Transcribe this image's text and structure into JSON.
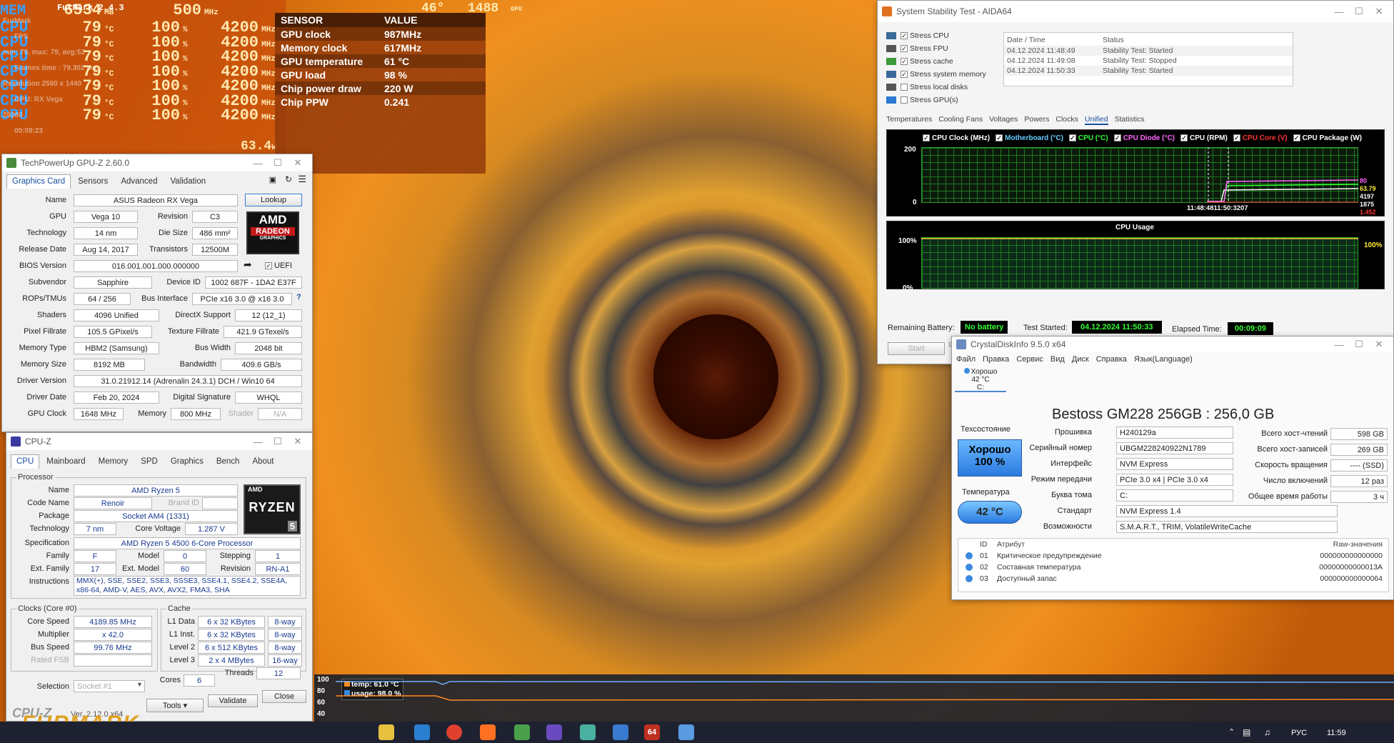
{
  "osd": {
    "rows": [
      {
        "name": "CPU",
        "v1": "79",
        "u1": "°C",
        "v2": "100",
        "u2": "%",
        "v3": "4200",
        "u3": "MHz"
      },
      {
        "name": "CPU",
        "v1": "79",
        "u1": "°C",
        "v2": "100",
        "u2": "%",
        "v3": "4200",
        "u3": "MHz"
      },
      {
        "name": "CPU",
        "v1": "79",
        "u1": "°C",
        "v2": "100",
        "u2": "%",
        "v3": "4200",
        "u3": "MHz"
      },
      {
        "name": "CPU",
        "v1": "79",
        "u1": "°C",
        "v2": "100",
        "u2": "%",
        "v3": "4200",
        "u3": "MHz"
      },
      {
        "name": "CPU",
        "v1": "79",
        "u1": "°C",
        "v2": "100",
        "u2": "%",
        "v3": "4200",
        "u3": "MHz"
      },
      {
        "name": "CPU",
        "v1": "79",
        "u1": "°C",
        "v2": "100",
        "u2": "%",
        "v3": "4200",
        "u3": "MHz"
      },
      {
        "name": "CPU",
        "v1": "79",
        "u1": "°C",
        "v2": "100",
        "u2": "%",
        "v3": "4200",
        "u3": "MHz"
      }
    ],
    "mem_row": {
      "name": "MEM",
      "v1": "6534",
      "u1": "MB",
      "v2": "500",
      "u2": "MHz"
    },
    "top_text": "FurMark 2.4.3",
    "gpu_top_fps": "1488",
    "gpu_top_unit": "GPU",
    "gpu_top_temp": "46°",
    "cpu_power": "63.4",
    "cpu_power_unit": "W",
    "faint_labels": [
      "FurMark",
      "FPS",
      "min: 79, max: 79, avg:52",
      "Frames time : 79.302 ms",
      "Resolution 2560 x 1440",
      "GPU: RX Vega",
      "29280",
      "00:09:23"
    ]
  },
  "sensor": {
    "header": [
      "SENSOR",
      "VALUE"
    ],
    "rows": [
      [
        "GPU clock",
        "987MHz"
      ],
      [
        "Memory clock",
        "617MHz"
      ],
      [
        "GPU temperature",
        "61 °C"
      ],
      [
        "GPU load",
        "98 %"
      ],
      [
        "Chip power draw",
        "220 W"
      ],
      [
        "Chip PPW",
        "0.241"
      ]
    ]
  },
  "gpuz": {
    "title": "TechPowerUp GPU-Z 2.60.0",
    "tabs": [
      "Graphics Card",
      "Sensors",
      "Advanced",
      "Validation"
    ],
    "lookup": "Lookup",
    "uefi": "UEFI",
    "rows": {
      "name_l": "Name",
      "name_v": "ASUS Radeon RX Vega",
      "gpu_l": "GPU",
      "gpu_v": "Vega 10",
      "rev_l": "Revision",
      "rev_v": "C3",
      "tech_l": "Technology",
      "tech_v": "14 nm",
      "die_l": "Die Size",
      "die_v": "486 mm²",
      "rel_l": "Release Date",
      "rel_v": "Aug 14, 2017",
      "tr_l": "Transistors",
      "tr_v": "12500M",
      "bios_l": "BIOS Version",
      "bios_v": "016.001.001.000.000000",
      "sub_l": "Subvendor",
      "sub_v": "Sapphire",
      "dev_l": "Device ID",
      "dev_v": "1002 687F - 1DA2 E37F",
      "rop_l": "ROPs/TMUs",
      "rop_v": "64 / 256",
      "bus_l": "Bus Interface",
      "bus_v": "PCIe x16 3.0 @ x16 3.0",
      "sh_l": "Shaders",
      "sh_v": "4096 Unified",
      "dx_l": "DirectX Support",
      "dx_v": "12 (12_1)",
      "pf_l": "Pixel Fillrate",
      "pf_v": "105.5 GPixel/s",
      "tf_l": "Texture Fillrate",
      "tf_v": "421.9 GTexel/s",
      "mt_l": "Memory Type",
      "mt_v": "HBM2 (Samsung)",
      "bw_l": "Bus Width",
      "bw_v": "2048 bit",
      "ms_l": "Memory Size",
      "ms_v": "8192 MB",
      "band_l": "Bandwidth",
      "band_v": "409.6 GB/s",
      "dv_l": "Driver Version",
      "dv_v": "31.0.21912.14 (Adrenalin 24.3.1) DCH / Win10 64",
      "dd_l": "Driver Date",
      "dd_v": "Feb 20, 2024",
      "ds_l": "Digital Signature",
      "ds_v": "WHQL",
      "gc_l": "GPU Clock",
      "gc_v": "1648 MHz",
      "mem_l": "Memory",
      "mem_v": "800 MHz",
      "shd_l": "Shader",
      "shd_v": "N/A"
    },
    "logo_top": "AMD",
    "logo_mid": "RADEON",
    "logo_bot": "GRAPHICS"
  },
  "cpuz": {
    "title": "CPU-Z",
    "tabs": [
      "CPU",
      "Mainboard",
      "Memory",
      "SPD",
      "Graphics",
      "Bench",
      "About"
    ],
    "processor_label": "Processor",
    "name_l": "Name",
    "name_v": "AMD Ryzen 5",
    "code_l": "Code Name",
    "code_v": "Renoir",
    "brand_l": "Brand ID",
    "pkg_l": "Package",
    "pkg_v": "Socket AM4 (1331)",
    "tech_l": "Technology",
    "tech_v": "7 nm",
    "cv_l": "Core Voltage",
    "cv_v": "1.287 V",
    "spec_l": "Specification",
    "spec_v": "AMD Ryzen 5 4500 6-Core Processor",
    "fam_l": "Family",
    "fam_v": "F",
    "model_l": "Model",
    "model_v": "0",
    "step_l": "Stepping",
    "step_v": "1",
    "efam_l": "Ext. Family",
    "efam_v": "17",
    "emodel_l": "Ext. Model",
    "emodel_v": "60",
    "rev_l": "Revision",
    "rev_v": "RN-A1",
    "inst_l": "Instructions",
    "inst_v": "MMX(+), SSE, SSE2, SSE3, SSSE3, SSE4.1, SSE4.2, SSE4A, x86-64, AMD-V, AES, AVX, AVX2, FMA3, SHA",
    "clocks_label": "Clocks (Core #0)",
    "cs_l": "Core Speed",
    "cs_v": "4189.85 MHz",
    "mul_l": "Multiplier",
    "mul_v": "x 42.0",
    "bs_l": "Bus Speed",
    "bs_v": "99.76 MHz",
    "rf_l": "Rated FSB",
    "cache_label": "Cache",
    "l1d_l": "L1 Data",
    "l1d_v": "6 x 32 KBytes",
    "l1d_w": "8-way",
    "l1i_l": "L1 Inst.",
    "l1i_v": "6 x 32 KBytes",
    "l1i_w": "8-way",
    "l2_l": "Level 2",
    "l2_v": "6 x 512 KBytes",
    "l2_w": "8-way",
    "l3_l": "Level 3",
    "l3_v": "2 x 4 MBytes",
    "l3_w": "16-way",
    "sel_l": "Selection",
    "sel_v": "Socket #1",
    "cores_l": "Cores",
    "cores_v": "6",
    "thr_l": "Threads",
    "thr_v": "12",
    "brand": "CPU-Z",
    "ver": "Ver. 2.12.0.x64",
    "tools": "Tools",
    "validate": "Validate",
    "close": "Close",
    "logo_amd": "AMD",
    "logo_ryzen": "RYZEN",
    "logo_num": "5"
  },
  "aida": {
    "title": "System Stability Test - AIDA64",
    "stress": [
      "Stress CPU",
      "Stress FPU",
      "Stress cache",
      "Stress system memory",
      "Stress local disks",
      "Stress GPU(s)"
    ],
    "log_headers": [
      "Date / Time",
      "Status"
    ],
    "log": [
      [
        "04.12.2024 11:48:49",
        "Stability Test: Started"
      ],
      [
        "04.12.2024 11:49:08",
        "Stability Test: Stopped"
      ],
      [
        "04.12.2024 11:50:33",
        "Stability Test: Started"
      ]
    ],
    "tabs": [
      "Temperatures",
      "Cooling Fans",
      "Voltages",
      "Powers",
      "Clocks",
      "Unified",
      "Statistics"
    ],
    "legend": [
      "CPU Clock (MHz)",
      "Motherboard (°C)",
      "CPU (°C)",
      "CPU Diode (°C)",
      "CPU (RPM)",
      "CPU Core (V)",
      "CPU Package (W)"
    ],
    "legend_colors": [
      "#ffffff",
      "#66ccff",
      "#33ff33",
      "#ff66ff",
      "#ffffff",
      "#ff3333",
      "#ffffff"
    ],
    "chart1_ymax": "200",
    "chart1_ymin": "0",
    "chart1_time": "11:48:4811:50:3207",
    "chart1_right": [
      "80",
      "63.79",
      "4197",
      "1875",
      "1.452"
    ],
    "chart2_title": "CPU Usage",
    "chart2_ymax": "100%",
    "chart2_ymin": "0%",
    "chart2_right": "100%",
    "battery_l": "Remaining Battery:",
    "battery_v": "No battery",
    "started_l": "Test Started:",
    "started_v": "04.12.2024 11:50:33",
    "elapsed_l": "Elapsed Time:",
    "elapsed_v": "00:09:09",
    "start_btn": "Start"
  },
  "crystal": {
    "title": "CrystalDiskInfo 9.5.0 x64",
    "menu": [
      "Файл",
      "Правка",
      "Сервис",
      "Вид",
      "Диск",
      "Справка",
      "Язык(Language)"
    ],
    "disk_status": "Хорошо",
    "disk_temp": "42 °C",
    "disk_letter": "C:",
    "model": "Bestoss GM228 256GB : 256,0 GB",
    "health_l": "Техсостояние",
    "health_v": "Хорошо",
    "health_pct": "100 %",
    "temp_l": "Температура",
    "temp_v": "42 °C",
    "fw_l": "Прошивка",
    "fw_v": "H240129a",
    "sn_l": "Серийный номер",
    "sn_v": "UBGM228240922N1789",
    "if_l": "Интерфейс",
    "if_v": "NVM Express",
    "mode_l": "Режим передачи",
    "mode_v": "PCIe 3.0 x4 | PCIe 3.0 x4",
    "vol_l": "Буква тома",
    "vol_v": "C:",
    "std_l": "Стандарт",
    "std_v": "NVM Express 1.4",
    "feat_l": "Возможности",
    "feat_v": "S.M.A.R.T., TRIM, VolatileWriteCache",
    "hr_l": "Всего хост-чтений",
    "hr_v": "598 GB",
    "hw_l": "Всего хост-записей",
    "hw_v": "269 GB",
    "rs_l": "Скорость вращения",
    "rs_v": "---- (SSD)",
    "pc_l": "Число включений",
    "pc_v": "12 раз",
    "ph_l": "Общее время работы",
    "ph_v": "3 ч",
    "attr_headers": [
      "ID",
      "Атрибут",
      "Raw-значения"
    ],
    "attrs": [
      [
        "01",
        "Критическое предупреждение",
        "000000000000000"
      ],
      [
        "02",
        "Составная температура",
        "00000000000013A"
      ],
      [
        "03",
        "Доступный запас",
        "000000000000064"
      ]
    ]
  },
  "furmark_graph": {
    "ylabels": [
      "100",
      "80",
      "60",
      "40"
    ],
    "temp_label": "temp: 61.0 °C",
    "usage_label": "usage: 98.0 %"
  },
  "furmark_logo": "FURMARK",
  "taskbar": {
    "lang": "РУС",
    "time": "11:59"
  }
}
